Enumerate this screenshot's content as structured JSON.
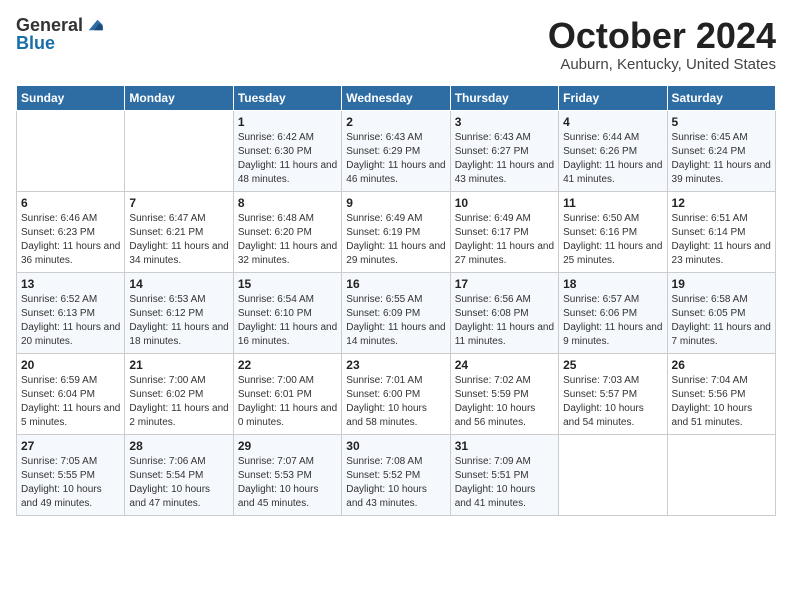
{
  "header": {
    "logo_general": "General",
    "logo_blue": "Blue",
    "month_title": "October 2024",
    "location": "Auburn, Kentucky, United States"
  },
  "days_of_week": [
    "Sunday",
    "Monday",
    "Tuesday",
    "Wednesday",
    "Thursday",
    "Friday",
    "Saturday"
  ],
  "weeks": [
    [
      {
        "day": "",
        "info": ""
      },
      {
        "day": "",
        "info": ""
      },
      {
        "day": "1",
        "info": "Sunrise: 6:42 AM\nSunset: 6:30 PM\nDaylight: 11 hours and 48 minutes."
      },
      {
        "day": "2",
        "info": "Sunrise: 6:43 AM\nSunset: 6:29 PM\nDaylight: 11 hours and 46 minutes."
      },
      {
        "day": "3",
        "info": "Sunrise: 6:43 AM\nSunset: 6:27 PM\nDaylight: 11 hours and 43 minutes."
      },
      {
        "day": "4",
        "info": "Sunrise: 6:44 AM\nSunset: 6:26 PM\nDaylight: 11 hours and 41 minutes."
      },
      {
        "day": "5",
        "info": "Sunrise: 6:45 AM\nSunset: 6:24 PM\nDaylight: 11 hours and 39 minutes."
      }
    ],
    [
      {
        "day": "6",
        "info": "Sunrise: 6:46 AM\nSunset: 6:23 PM\nDaylight: 11 hours and 36 minutes."
      },
      {
        "day": "7",
        "info": "Sunrise: 6:47 AM\nSunset: 6:21 PM\nDaylight: 11 hours and 34 minutes."
      },
      {
        "day": "8",
        "info": "Sunrise: 6:48 AM\nSunset: 6:20 PM\nDaylight: 11 hours and 32 minutes."
      },
      {
        "day": "9",
        "info": "Sunrise: 6:49 AM\nSunset: 6:19 PM\nDaylight: 11 hours and 29 minutes."
      },
      {
        "day": "10",
        "info": "Sunrise: 6:49 AM\nSunset: 6:17 PM\nDaylight: 11 hours and 27 minutes."
      },
      {
        "day": "11",
        "info": "Sunrise: 6:50 AM\nSunset: 6:16 PM\nDaylight: 11 hours and 25 minutes."
      },
      {
        "day": "12",
        "info": "Sunrise: 6:51 AM\nSunset: 6:14 PM\nDaylight: 11 hours and 23 minutes."
      }
    ],
    [
      {
        "day": "13",
        "info": "Sunrise: 6:52 AM\nSunset: 6:13 PM\nDaylight: 11 hours and 20 minutes."
      },
      {
        "day": "14",
        "info": "Sunrise: 6:53 AM\nSunset: 6:12 PM\nDaylight: 11 hours and 18 minutes."
      },
      {
        "day": "15",
        "info": "Sunrise: 6:54 AM\nSunset: 6:10 PM\nDaylight: 11 hours and 16 minutes."
      },
      {
        "day": "16",
        "info": "Sunrise: 6:55 AM\nSunset: 6:09 PM\nDaylight: 11 hours and 14 minutes."
      },
      {
        "day": "17",
        "info": "Sunrise: 6:56 AM\nSunset: 6:08 PM\nDaylight: 11 hours and 11 minutes."
      },
      {
        "day": "18",
        "info": "Sunrise: 6:57 AM\nSunset: 6:06 PM\nDaylight: 11 hours and 9 minutes."
      },
      {
        "day": "19",
        "info": "Sunrise: 6:58 AM\nSunset: 6:05 PM\nDaylight: 11 hours and 7 minutes."
      }
    ],
    [
      {
        "day": "20",
        "info": "Sunrise: 6:59 AM\nSunset: 6:04 PM\nDaylight: 11 hours and 5 minutes."
      },
      {
        "day": "21",
        "info": "Sunrise: 7:00 AM\nSunset: 6:02 PM\nDaylight: 11 hours and 2 minutes."
      },
      {
        "day": "22",
        "info": "Sunrise: 7:00 AM\nSunset: 6:01 PM\nDaylight: 11 hours and 0 minutes."
      },
      {
        "day": "23",
        "info": "Sunrise: 7:01 AM\nSunset: 6:00 PM\nDaylight: 10 hours and 58 minutes."
      },
      {
        "day": "24",
        "info": "Sunrise: 7:02 AM\nSunset: 5:59 PM\nDaylight: 10 hours and 56 minutes."
      },
      {
        "day": "25",
        "info": "Sunrise: 7:03 AM\nSunset: 5:57 PM\nDaylight: 10 hours and 54 minutes."
      },
      {
        "day": "26",
        "info": "Sunrise: 7:04 AM\nSunset: 5:56 PM\nDaylight: 10 hours and 51 minutes."
      }
    ],
    [
      {
        "day": "27",
        "info": "Sunrise: 7:05 AM\nSunset: 5:55 PM\nDaylight: 10 hours and 49 minutes."
      },
      {
        "day": "28",
        "info": "Sunrise: 7:06 AM\nSunset: 5:54 PM\nDaylight: 10 hours and 47 minutes."
      },
      {
        "day": "29",
        "info": "Sunrise: 7:07 AM\nSunset: 5:53 PM\nDaylight: 10 hours and 45 minutes."
      },
      {
        "day": "30",
        "info": "Sunrise: 7:08 AM\nSunset: 5:52 PM\nDaylight: 10 hours and 43 minutes."
      },
      {
        "day": "31",
        "info": "Sunrise: 7:09 AM\nSunset: 5:51 PM\nDaylight: 10 hours and 41 minutes."
      },
      {
        "day": "",
        "info": ""
      },
      {
        "day": "",
        "info": ""
      }
    ]
  ]
}
